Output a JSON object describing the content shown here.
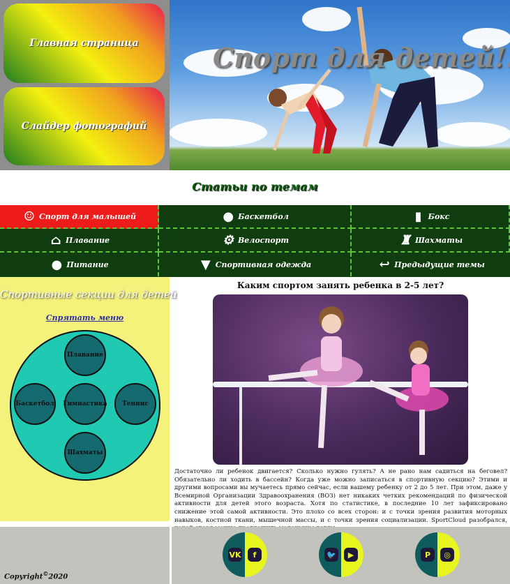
{
  "nav": {
    "home": "Главная страница",
    "slider": "Слайдер фотографий"
  },
  "hero": {
    "title": "Спорт для детей!!!"
  },
  "topics": {
    "title": "Статьи по темам",
    "items": [
      {
        "label": "Спорт для малышей",
        "icon": "baby-face-icon",
        "glyph": "☺"
      },
      {
        "label": "Баскетбол",
        "icon": "basketball-icon",
        "glyph": "●"
      },
      {
        "label": "Бокс",
        "icon": "boxing-glove-icon",
        "glyph": "▮"
      },
      {
        "label": "Плавание",
        "icon": "swimming-pool-icon",
        "glyph": "⌂"
      },
      {
        "label": "Велоспорт",
        "icon": "bicycle-icon",
        "glyph": "⚙"
      },
      {
        "label": "Шахматы",
        "icon": "chess-rook-icon",
        "glyph": "♜"
      },
      {
        "label": "Питание",
        "icon": "apple-icon",
        "glyph": "●"
      },
      {
        "label": "Спортивная одежда",
        "icon": "tshirt-icon",
        "glyph": "▼"
      },
      {
        "label": "Предыдущие темы",
        "icon": "back-arrow-icon",
        "glyph": "↩"
      }
    ]
  },
  "sidebar": {
    "title": "Спортивные секции для детей",
    "hide_menu": "Спрятать меню",
    "sections": {
      "top": "Плавание",
      "left": "Баскетбол",
      "center": "Гимнастика",
      "right": "Теннис",
      "bottom": "Шахматы"
    }
  },
  "article": {
    "title": "Каким спортом занять ребенка в 2-5 лет?",
    "text": "Достаточно ли ребенок двигается? Сколько нужно гулять? А не рано нам садиться на беговел? Обязательно ли ходить в бассейн? Когда уже можно записаться в спортивную секцию? Этими и другими вопросами вы мучаетесь прямо сейчас, если вашему ребенку от 2 до 5 лет. При этом, даже у Всемирной Организации Здравоохранения (ВОЗ) нет никаких четких рекомендаций по физической активности для детей этого возраста. Хотя по статистике, в последние 10 лет зафиксировано снижение этой самой активности. Это плохо со всех сторон: и с точки зрения развития моторных навыков, костной ткани, мышечной массы, и с точки зрения социализации. SportCloud разобрался, какой спорт можно предложить маленьким детям."
  },
  "footer": {
    "copyright": "Copyright",
    "copyright_symbol": "©",
    "year": "2020",
    "social": [
      {
        "left": "VK",
        "left_icon": "vk-icon",
        "right": "f",
        "right_icon": "facebook-icon"
      },
      {
        "left": "🐦",
        "left_icon": "twitter-icon",
        "right": "▶",
        "right_icon": "youtube-icon"
      },
      {
        "left": "P",
        "left_icon": "pinterest-icon",
        "right": "◎",
        "right_icon": "instagram-icon"
      }
    ]
  }
}
